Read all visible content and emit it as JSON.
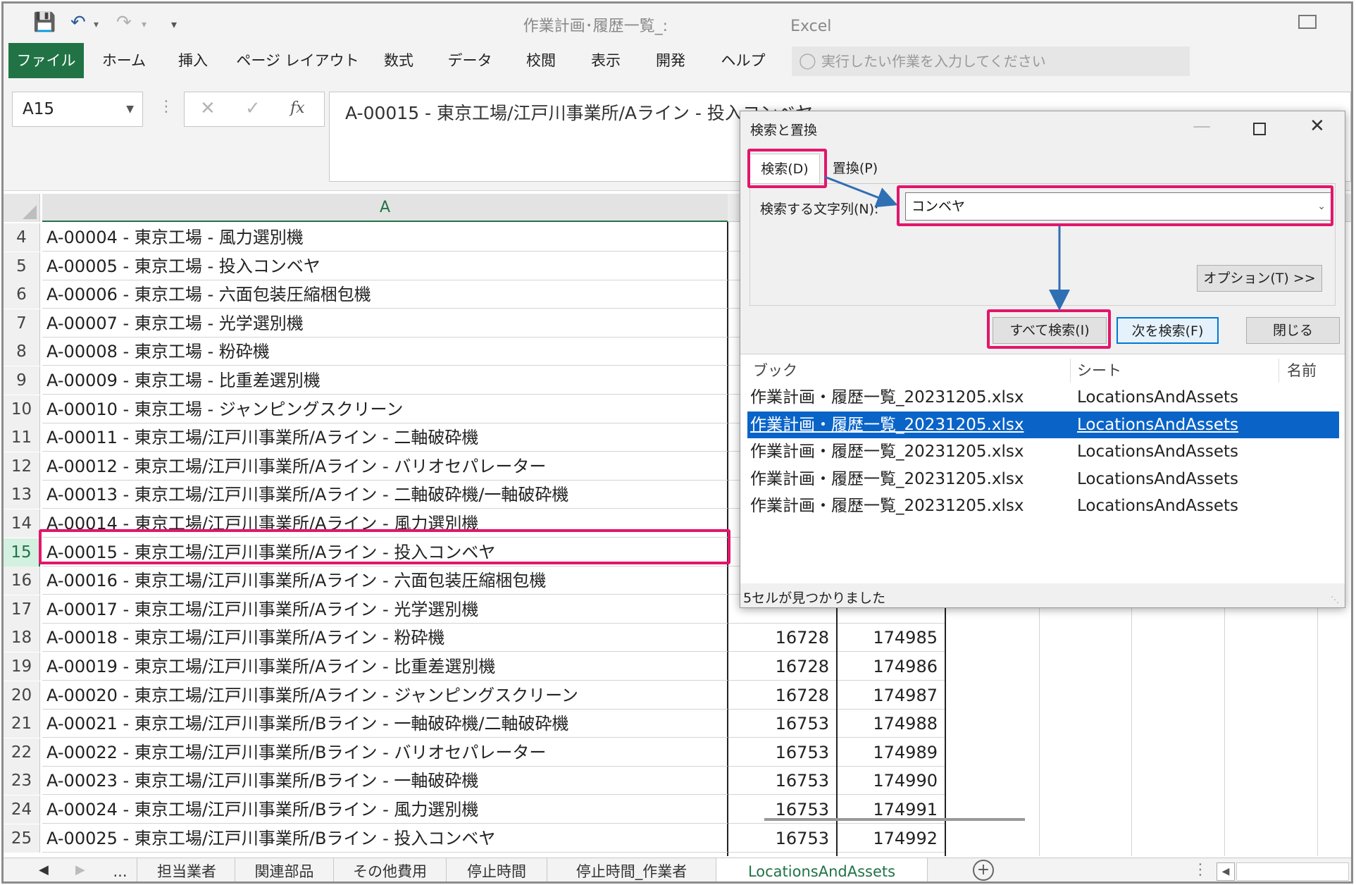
{
  "window": {
    "title": "作業計画･履歴一覧_:",
    "app_name": "Excel"
  },
  "ribbon": {
    "tabs": [
      "ファイル",
      "ホーム",
      "挿入",
      "ページ レイアウト",
      "数式",
      "データ",
      "校閲",
      "表示",
      "開発",
      "ヘルプ"
    ],
    "tell_me_placeholder": "実行したい作業を入力してください"
  },
  "formula_bar": {
    "name_box": "A15",
    "fx_label": "fx",
    "formula": "A-00015 - 東京工場/江戸川事業所/Aライン - 投入コンベヤ"
  },
  "sheet": {
    "column_a_header": "A",
    "rows": [
      {
        "num": "4",
        "a": "A-00004 - 東京工場 - 風力選別機",
        "b": "",
        "c": ""
      },
      {
        "num": "5",
        "a": "A-00005 - 東京工場 - 投入コンベヤ",
        "b": "",
        "c": ""
      },
      {
        "num": "6",
        "a": "A-00006 - 東京工場 - 六面包装圧縮梱包機",
        "b": "",
        "c": ""
      },
      {
        "num": "7",
        "a": "A-00007 - 東京工場 - 光学選別機",
        "b": "",
        "c": ""
      },
      {
        "num": "8",
        "a": "A-00008 - 東京工場 - 粉砕機",
        "b": "",
        "c": ""
      },
      {
        "num": "9",
        "a": "A-00009 - 東京工場 - 比重差選別機",
        "b": "",
        "c": ""
      },
      {
        "num": "10",
        "a": "A-00010 - 東京工場 - ジャンピングスクリーン",
        "b": "",
        "c": ""
      },
      {
        "num": "11",
        "a": "A-00011 - 東京工場/江戸川事業所/Aライン - 二軸破砕機",
        "b": "",
        "c": ""
      },
      {
        "num": "12",
        "a": "A-00012 - 東京工場/江戸川事業所/Aライン - バリオセパレーター",
        "b": "",
        "c": ""
      },
      {
        "num": "13",
        "a": "A-00013 - 東京工場/江戸川事業所/Aライン - 二軸破砕機/一軸破砕機",
        "b": "",
        "c": ""
      },
      {
        "num": "14",
        "a": "A-00014 - 東京工場/江戸川事業所/Aライン - 風力選別機",
        "b": "",
        "c": ""
      },
      {
        "num": "15",
        "a": "A-00015 - 東京工場/江戸川事業所/Aライン - 投入コンベヤ",
        "b": "",
        "c": ""
      },
      {
        "num": "16",
        "a": "A-00016 - 東京工場/江戸川事業所/Aライン - 六面包装圧縮梱包機",
        "b": "",
        "c": ""
      },
      {
        "num": "17",
        "a": "A-00017 - 東京工場/江戸川事業所/Aライン - 光学選別機",
        "b": "",
        "c": ""
      },
      {
        "num": "18",
        "a": "A-00018 - 東京工場/江戸川事業所/Aライン - 粉砕機",
        "b": "16728",
        "c": "174985"
      },
      {
        "num": "19",
        "a": "A-00019 - 東京工場/江戸川事業所/Aライン - 比重差選別機",
        "b": "16728",
        "c": "174986"
      },
      {
        "num": "20",
        "a": "A-00020 - 東京工場/江戸川事業所/Aライン - ジャンピングスクリーン",
        "b": "16728",
        "c": "174987"
      },
      {
        "num": "21",
        "a": "A-00021 - 東京工場/江戸川事業所/Bライン - 一軸破砕機/二軸破砕機",
        "b": "16753",
        "c": "174988"
      },
      {
        "num": "22",
        "a": "A-00022 - 東京工場/江戸川事業所/Bライン - バリオセパレーター",
        "b": "16753",
        "c": "174989"
      },
      {
        "num": "23",
        "a": "A-00023 - 東京工場/江戸川事業所/Bライン - 一軸破砕機",
        "b": "16753",
        "c": "174990"
      },
      {
        "num": "24",
        "a": "A-00024 - 東京工場/江戸川事業所/Bライン - 風力選別機",
        "b": "16753",
        "c": "174991"
      },
      {
        "num": "25",
        "a": "A-00025 - 東京工場/江戸川事業所/Bライン - 投入コンベヤ",
        "b": "16753",
        "c": "174992"
      }
    ]
  },
  "sheet_tabs": {
    "ellipsis": "...",
    "tabs": [
      "担当業者",
      "関連部品",
      "その他費用",
      "停止時間",
      "停止時間_作業者",
      "LocationsAndAssets"
    ],
    "active": "LocationsAndAssets"
  },
  "dialog": {
    "title": "検索と置換",
    "tab_find": "検索(D)",
    "tab_replace": "置換(P)",
    "search_label": "検索する文字列(N):",
    "search_value": "コンベヤ",
    "options_button": "オプション(T) >>",
    "find_all_button": "すべて検索(I)",
    "find_next_button": "次を検索(F)",
    "close_button": "閉じる",
    "results_headers": [
      "ブック",
      "シート",
      "名前"
    ],
    "results": [
      {
        "book": "作業計画・履歴一覧_20231205.xlsx",
        "sheet": "LocationsAndAssets"
      },
      {
        "book": "作業計画・履歴一覧_20231205.xlsx",
        "sheet": "LocationsAndAssets"
      },
      {
        "book": "作業計画・履歴一覧_20231205.xlsx",
        "sheet": "LocationsAndAssets"
      },
      {
        "book": "作業計画・履歴一覧_20231205.xlsx",
        "sheet": "LocationsAndAssets"
      },
      {
        "book": "作業計画・履歴一覧_20231205.xlsx",
        "sheet": "LocationsAndAssets"
      }
    ],
    "status": "5セルが見つかりました"
  },
  "colors": {
    "excel_green": "#217346",
    "annotation": "#e2166b",
    "arrow": "#2f6fb3",
    "selection": "#0a64c8"
  }
}
